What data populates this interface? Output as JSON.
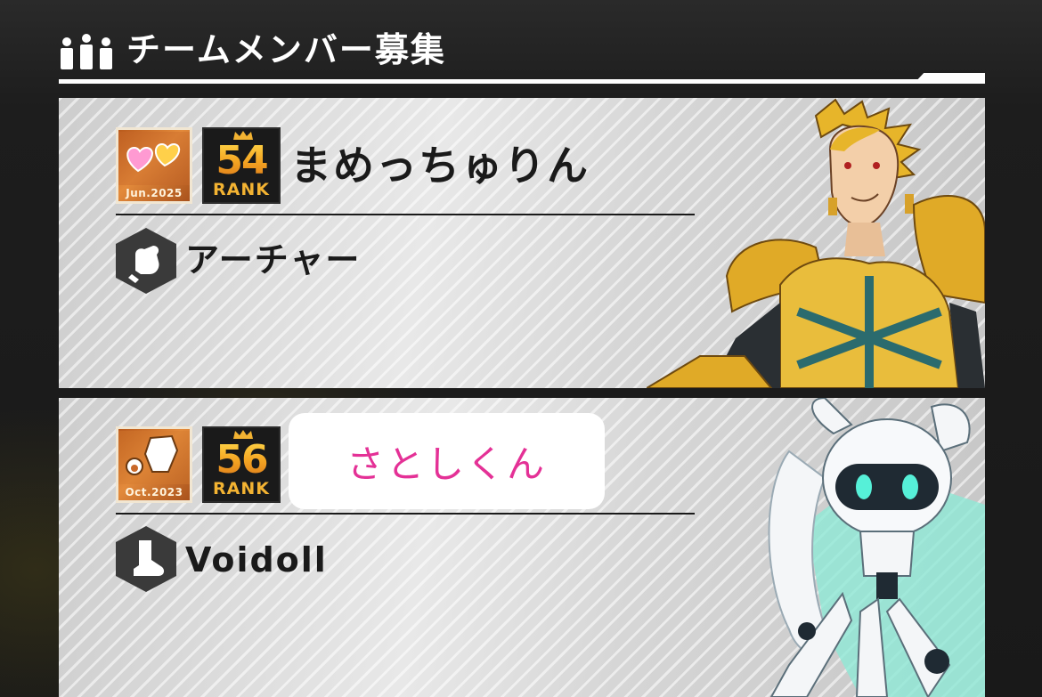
{
  "header": {
    "title": "チームメンバー募集",
    "icon": "team-members-icon"
  },
  "colors": {
    "background": "#1c1c1c",
    "card": "#dcdcdc",
    "rank_gold": "#f4a522",
    "name_pink": "#e43196"
  },
  "members": [
    {
      "badge": {
        "icon": "hearts-badge-icon",
        "date": "Jun.2025"
      },
      "rank": {
        "number": "54",
        "label": "RANK"
      },
      "player_name": "まめっちゅりん",
      "name_boxed": false,
      "role_icon": "fist-role-icon",
      "character": "アーチャー",
      "portrait": "golden-armor-hero-portrait"
    },
    {
      "badge": {
        "icon": "robot-paw-badge-icon",
        "date": "Oct.2023"
      },
      "rank": {
        "number": "56",
        "label": "RANK"
      },
      "player_name": "さとしくん",
      "name_boxed": true,
      "role_icon": "boot-role-icon",
      "character": "Voidoll",
      "portrait": "white-robot-portrait"
    }
  ]
}
